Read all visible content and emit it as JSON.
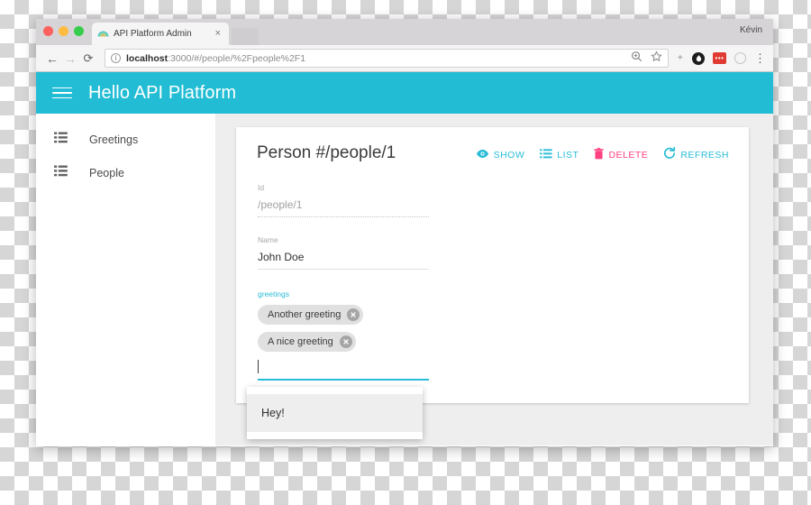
{
  "browser": {
    "tab": {
      "title": "API Platform Admin",
      "close_glyph": "×",
      "favicon": "api-platform-logo"
    },
    "user": "Kévin",
    "nav": {
      "back": "←",
      "forward": "→",
      "reload": "⟳"
    },
    "omnibox": {
      "info_glyph": "ⓘ",
      "url_host": "localhost",
      "url_rest": ":3000/#/people/%2Fpeople%2F1",
      "url_full": "localhost:3000/#/people/%2Fpeople%2F1",
      "zoom_icon": "⌕",
      "bookmark_icon": "☆"
    },
    "extensions": [
      {
        "name": "sparkle-icon",
        "glyph": "✦"
      },
      {
        "name": "dark-circle-icon",
        "glyph": "●"
      },
      {
        "name": "red-extension-icon",
        "glyph": "•••"
      },
      {
        "name": "gray-ring-icon",
        "glyph": ""
      }
    ],
    "menu_glyph": "⋮"
  },
  "app": {
    "header": {
      "title": "Hello API Platform",
      "menu_icon": "hamburger-menu"
    },
    "accent_color": "#22bdd4",
    "danger_color": "#ff4081",
    "sidebar": {
      "items": [
        {
          "label": "Greetings",
          "icon": "list-icon"
        },
        {
          "label": "People",
          "icon": "list-icon"
        }
      ]
    },
    "card": {
      "title": "Person #/people/1",
      "actions": [
        {
          "label": "SHOW",
          "icon": "eye-icon",
          "color": "cyan"
        },
        {
          "label": "LIST",
          "icon": "list-icon",
          "color": "cyan"
        },
        {
          "label": "DELETE",
          "icon": "trash-icon",
          "color": "pink"
        },
        {
          "label": "REFRESH",
          "icon": "refresh-icon",
          "color": "cyan"
        }
      ],
      "fields": {
        "id": {
          "label": "Id",
          "value": "/people/1",
          "disabled": true
        },
        "name": {
          "label": "Name",
          "value": "John Doe",
          "disabled": false
        },
        "greetings": {
          "label": "greetings",
          "focused": true,
          "chips": [
            {
              "label": "Another greeting",
              "remove_glyph": "×"
            },
            {
              "label": "A nice greeting",
              "remove_glyph": "×"
            }
          ],
          "input_value": "",
          "suggestions": [
            "Hey!"
          ]
        }
      },
      "save_button": {
        "label": ""
      }
    }
  }
}
